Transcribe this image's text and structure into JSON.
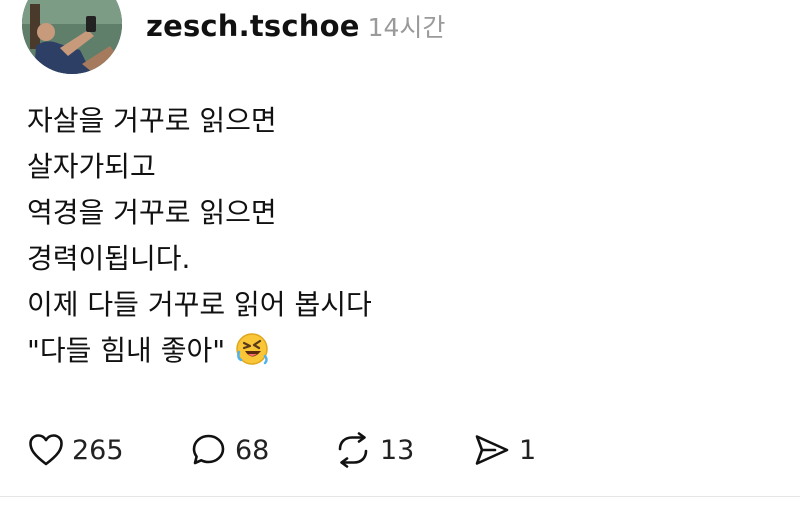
{
  "post": {
    "author": {
      "username": "zesch.tschoe",
      "time": "14시간"
    },
    "lines": [
      "자살을 거꾸로 읽으면",
      "살자가되고",
      "역경을 거꾸로 읽으면",
      "경력이됩니다.",
      "이제 다들 거꾸로 읽어 봅시다",
      "\"다들 힘내 좋아\""
    ],
    "emoji": "rolling-on-the-floor-laughing-face",
    "actions": {
      "likes": "265",
      "comments": "68",
      "reposts": "13",
      "shares": "1"
    }
  },
  "colors": {
    "text": "#111111",
    "muted": "#9a9a9a",
    "divider": "#e6e6e6",
    "emoji": "#f8c636"
  }
}
